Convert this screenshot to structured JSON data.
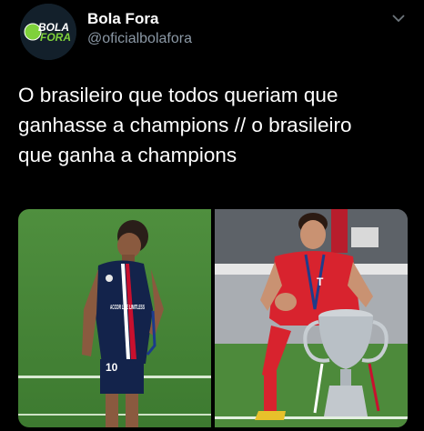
{
  "account": {
    "display_name": "Bola Fora",
    "handle": "@oficialbolafora",
    "avatar_text_1": "BOLA",
    "avatar_text_2": "FORA"
  },
  "tweet": {
    "line1": "O brasileiro que todos queriam que",
    "line2": "ganhasse a champions // o brasileiro",
    "line3": "que ganha a champions"
  },
  "media": {
    "left_photo": {
      "jersey_number": "10",
      "sponsor": "ACCOR LIVE LIMITLESS"
    },
    "right_photo": {
      "sponsor": "T"
    }
  },
  "icons": {
    "more": "chevron-down-icon"
  },
  "colors": {
    "background": "#000000",
    "secondary_text": "#8b98a5",
    "avatar_green": "#7fd13b"
  }
}
